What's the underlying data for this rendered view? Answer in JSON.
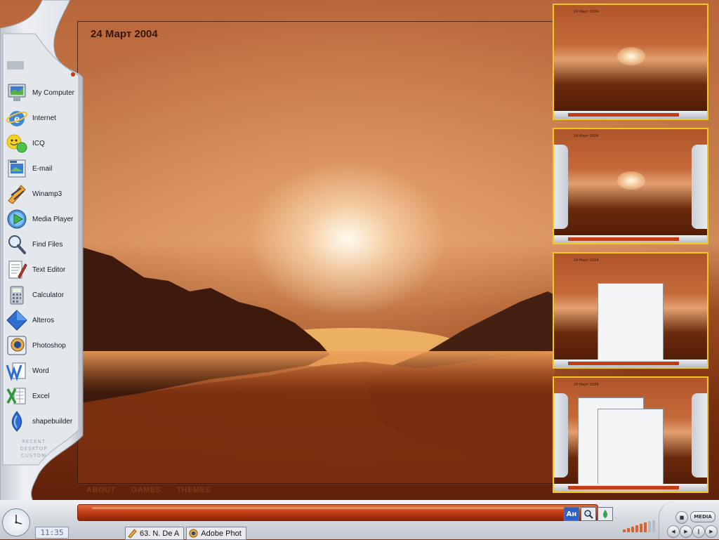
{
  "desktop": {
    "date": "24  Март 2004",
    "bottom_links": [
      "ABOUT",
      "GAMES",
      "THEMES"
    ]
  },
  "sidebar": {
    "items": [
      {
        "label": "My Computer",
        "icon": "my-computer-icon"
      },
      {
        "label": "Internet",
        "icon": "internet-explorer-icon"
      },
      {
        "label": "ICQ",
        "icon": "icq-icon"
      },
      {
        "label": "E-mail",
        "icon": "email-icon"
      },
      {
        "label": "Winamp3",
        "icon": "winamp-icon"
      },
      {
        "label": "Media Player",
        "icon": "media-player-icon"
      },
      {
        "label": "Find Files",
        "icon": "search-icon"
      },
      {
        "label": "Text Editor",
        "icon": "text-editor-icon"
      },
      {
        "label": "Calculator",
        "icon": "calculator-icon"
      },
      {
        "label": "Alteros",
        "icon": "alteros-icon"
      },
      {
        "label": "Photoshop",
        "icon": "photoshop-icon"
      },
      {
        "label": "Word",
        "icon": "word-icon"
      },
      {
        "label": "Excel",
        "icon": "excel-icon"
      },
      {
        "label": "shapebuilder",
        "icon": "shapebuilder-icon"
      }
    ],
    "links": [
      "RECENT",
      "DESKTOP",
      "CUSTOM"
    ]
  },
  "taskbar": {
    "clock": "11:35",
    "language": "Ан",
    "tasks": [
      {
        "label": "63. N. De A",
        "icon": "winamp-icon"
      },
      {
        "label": "Adobe Phot",
        "icon": "photoshop-icon"
      }
    ],
    "media_label": "MEDIA"
  },
  "colors": {
    "thumb_border": "#f3c81e",
    "taskbar_red": "#c23d16",
    "sidebar_silver": "#dfe3e9"
  }
}
